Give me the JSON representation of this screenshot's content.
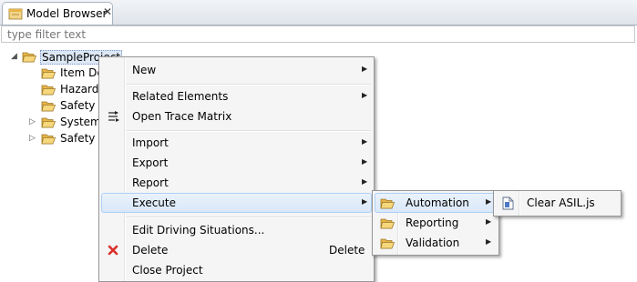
{
  "view": {
    "title": "Model Browser",
    "close_glyph": "✕",
    "filter_placeholder": "type filter text"
  },
  "tree": {
    "root": "SampleProject",
    "children": [
      "Item Def",
      "Hazard A",
      "Safety G",
      "System I",
      "Safety A"
    ]
  },
  "context_menu": {
    "new": "New",
    "related_elements": "Related Elements",
    "open_trace_matrix": "Open Trace Matrix",
    "import": "Import",
    "export": "Export",
    "report": "Report",
    "execute": "Execute",
    "edit_driving_situations": "Edit Driving Situations...",
    "delete": "Delete",
    "delete_shortcut": "Delete",
    "close_project": "Close Project"
  },
  "execute_submenu": {
    "automation": "Automation",
    "reporting": "Reporting",
    "validation": "Validation"
  },
  "automation_submenu": {
    "clear_asil": "Clear ASIL.js"
  },
  "colors": {
    "folder": "#f0c45a",
    "highlight": "#d9e8f9",
    "delete_icon": "#d9302a"
  },
  "icons": [
    "folder-icon",
    "trace-matrix-icon",
    "delete-icon",
    "script-file-icon",
    "submenu-arrow-icon",
    "close-icon"
  ]
}
